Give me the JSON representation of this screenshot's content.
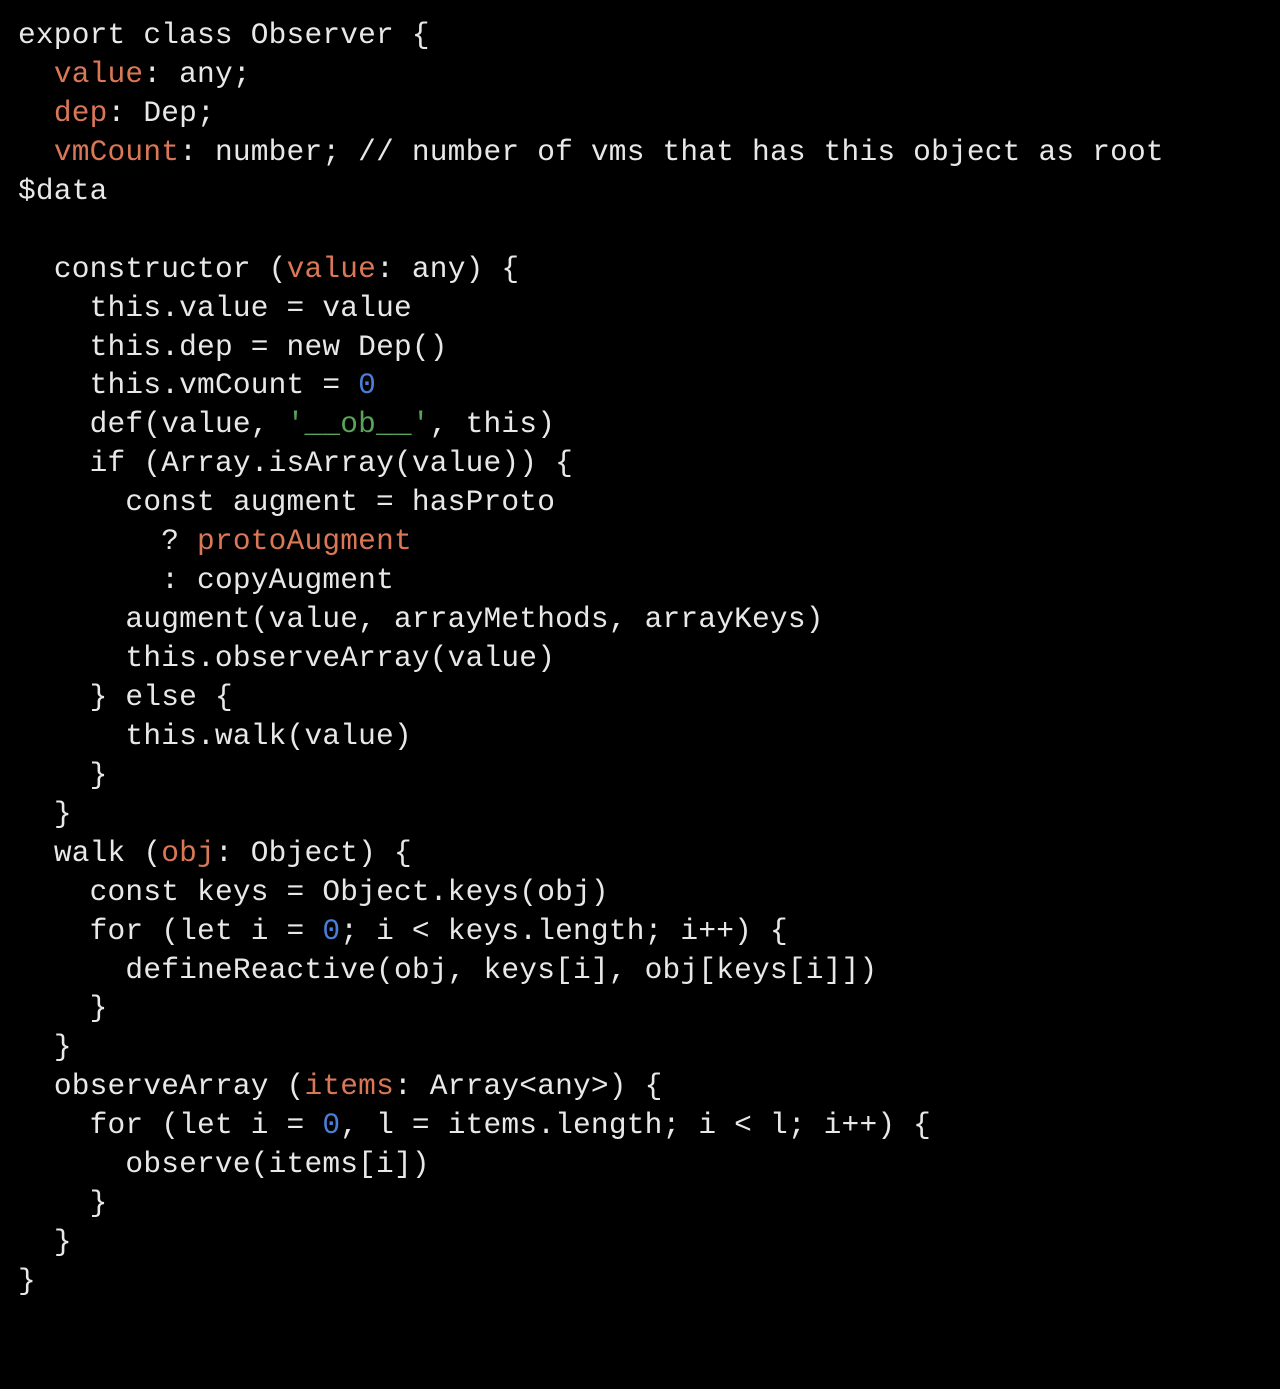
{
  "code": {
    "tokens": [
      {
        "t": "export class Observer {\n"
      },
      {
        "t": "  "
      },
      {
        "t": "value",
        "c": "prop"
      },
      {
        "t": ": any;\n"
      },
      {
        "t": "  "
      },
      {
        "t": "dep",
        "c": "prop"
      },
      {
        "t": ": Dep;\n"
      },
      {
        "t": "  "
      },
      {
        "t": "vmCount",
        "c": "prop"
      },
      {
        "t": ": number; "
      },
      {
        "t": "// number of vms that has this object as root $data",
        "c": "cmt"
      },
      {
        "t": "\n"
      },
      {
        "t": "\n"
      },
      {
        "t": "  constructor ("
      },
      {
        "t": "value",
        "c": "prop"
      },
      {
        "t": ": any) {\n"
      },
      {
        "t": "    this.value = value\n"
      },
      {
        "t": "    this.dep = new Dep()\n"
      },
      {
        "t": "    this.vmCount = "
      },
      {
        "t": "0",
        "c": "num"
      },
      {
        "t": "\n"
      },
      {
        "t": "    def(value, "
      },
      {
        "t": "'__ob__'",
        "c": "str"
      },
      {
        "t": ", this)\n"
      },
      {
        "t": "    if (Array.isArray(value)) {\n"
      },
      {
        "t": "      const augment = hasProto\n"
      },
      {
        "t": "        ? "
      },
      {
        "t": "protoAugment",
        "c": "prop"
      },
      {
        "t": "\n"
      },
      {
        "t": "        : copyAugment\n"
      },
      {
        "t": "      augment(value, arrayMethods, arrayKeys)\n"
      },
      {
        "t": "      this.observeArray(value)\n"
      },
      {
        "t": "    } else {\n"
      },
      {
        "t": "      this.walk(value)\n"
      },
      {
        "t": "    }\n"
      },
      {
        "t": "  }\n"
      },
      {
        "t": "  walk ("
      },
      {
        "t": "obj",
        "c": "prop"
      },
      {
        "t": ": Object) {\n"
      },
      {
        "t": "    const keys = Object.keys(obj)\n"
      },
      {
        "t": "    for (let i = "
      },
      {
        "t": "0",
        "c": "num"
      },
      {
        "t": "; i < keys.length; i++) {\n"
      },
      {
        "t": "      defineReactive(obj, keys[i], obj[keys[i]])\n"
      },
      {
        "t": "    }\n"
      },
      {
        "t": "  }\n"
      },
      {
        "t": "  observeArray ("
      },
      {
        "t": "items",
        "c": "prop"
      },
      {
        "t": ": Array<any>) {\n"
      },
      {
        "t": "    for (let i = "
      },
      {
        "t": "0",
        "c": "num"
      },
      {
        "t": ", l = items.length; i < l; i++) {\n"
      },
      {
        "t": "      observe(items[i])\n"
      },
      {
        "t": "    }\n"
      },
      {
        "t": "  }\n"
      },
      {
        "t": "}\n"
      }
    ]
  }
}
